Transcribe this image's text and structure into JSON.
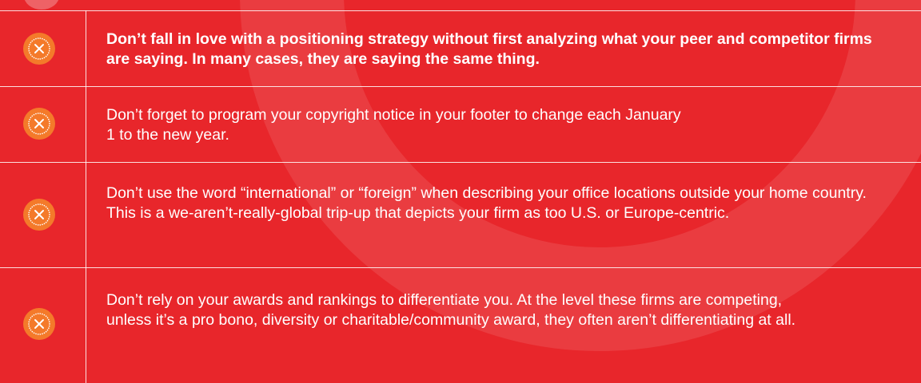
{
  "colors": {
    "background": "#e8262b",
    "icon": "#f47a2a",
    "text": "#ffffff"
  },
  "rows": [
    {
      "icon": "x-circle-icon",
      "text": "Don’t fall in love with a positioning strategy without first analyzing what your peer and competitor firms are saying. In many cases, they are saying the same thing."
    },
    {
      "icon": "x-circle-icon",
      "text": "Don’t forget to program your copyright notice in your footer to change each January 1 to the new year."
    },
    {
      "icon": "x-circle-icon",
      "text": "Don’t use the word “international” or “foreign” when describing your office locations outside your home country. This is a we-aren’t-really-global trip-up that depicts your firm as too U.S. or Europe-centric."
    },
    {
      "icon": "x-circle-icon",
      "text": "Don’t rely on your awards and rankings to differentiate you. At the level these firms are competing, unless it’s a pro bono, diversity or charitable/community award, they often aren’t differentiating at all."
    }
  ]
}
